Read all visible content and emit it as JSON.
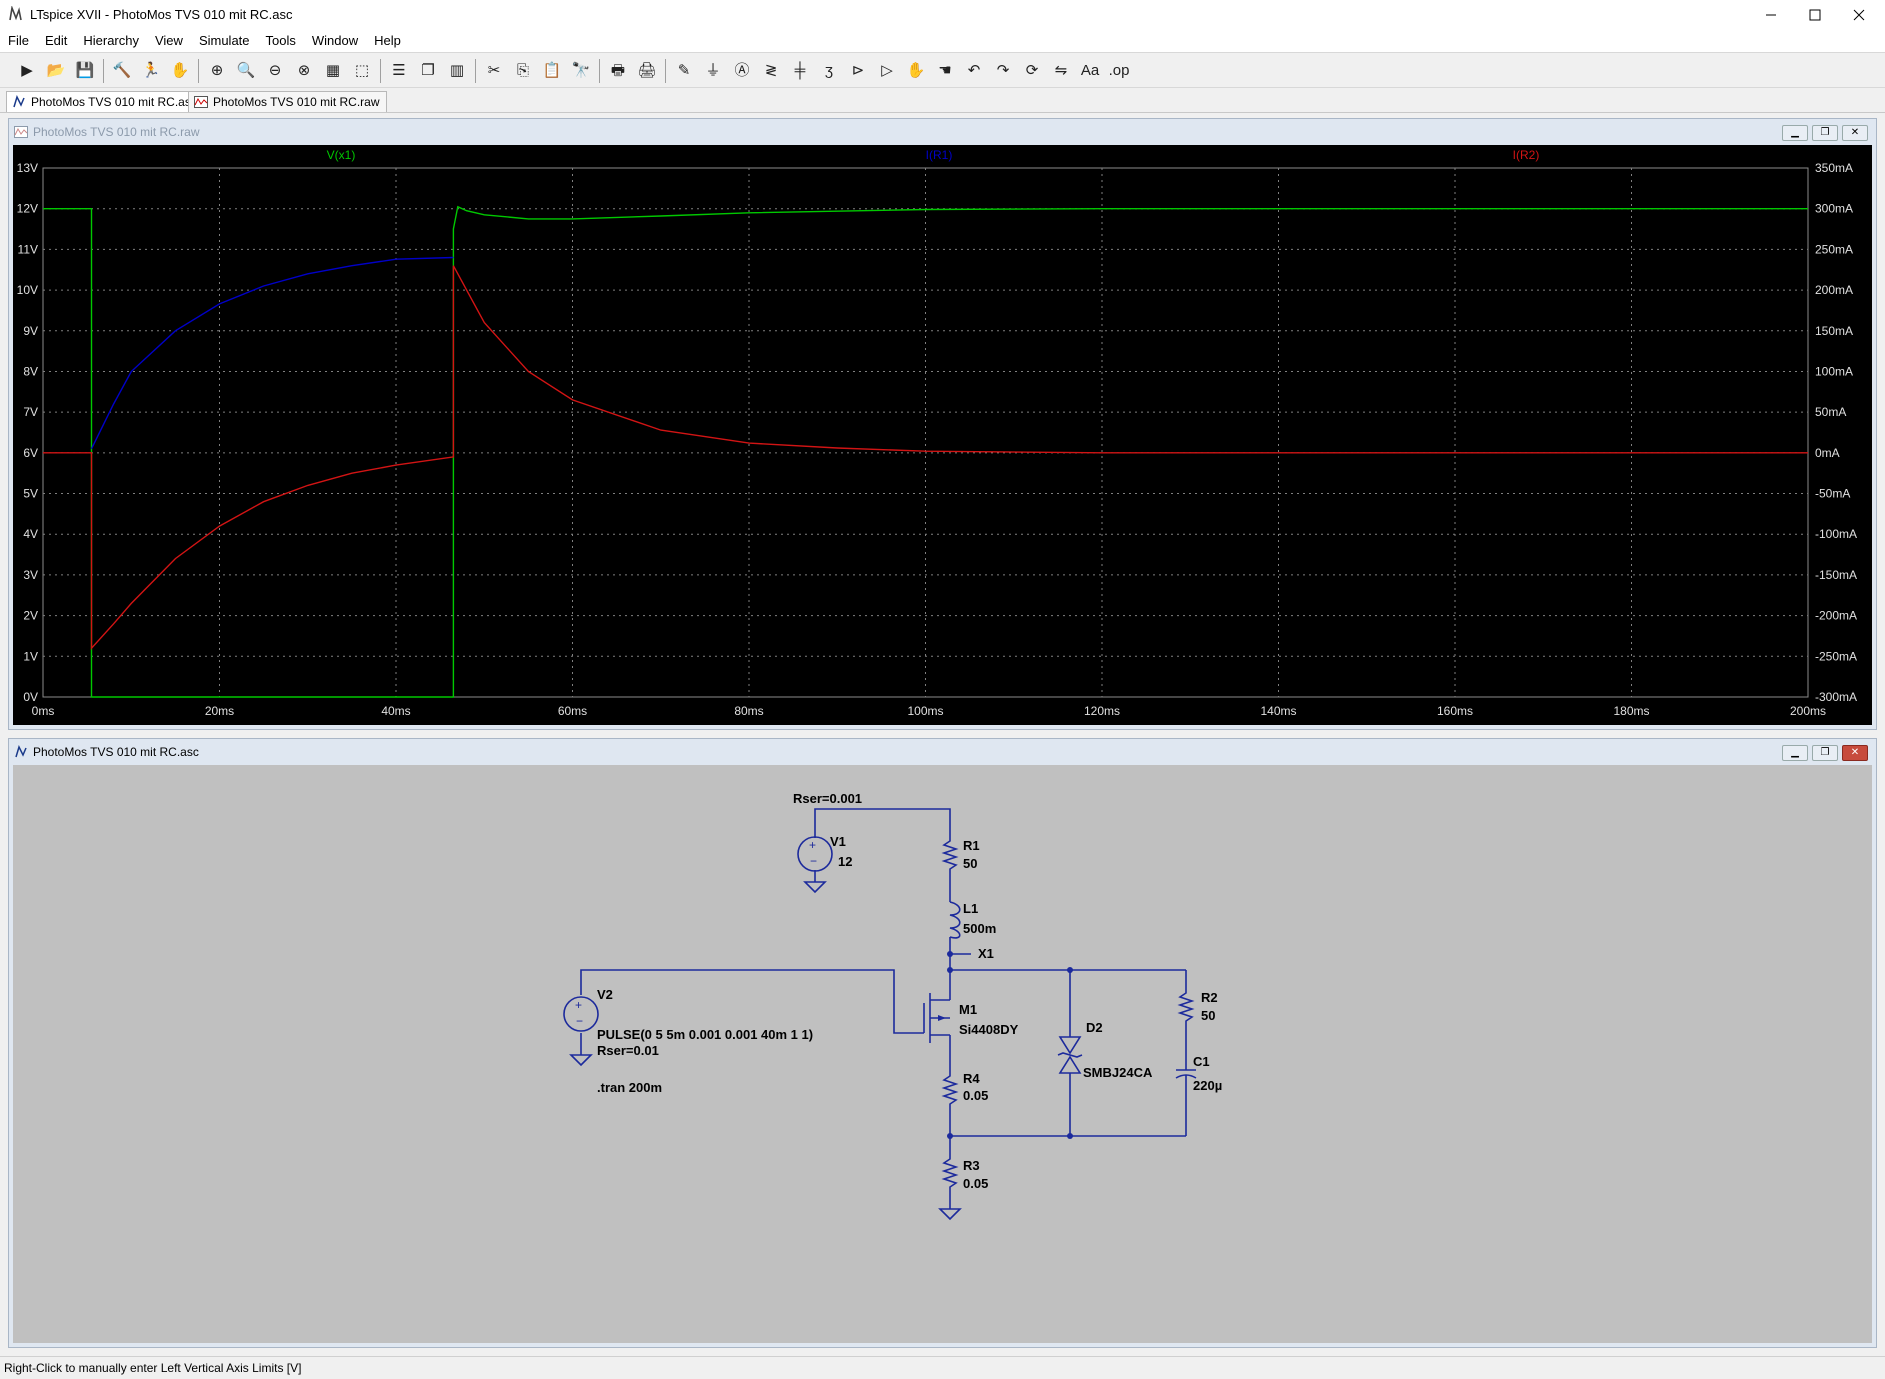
{
  "window": {
    "title": "LTspice XVII - PhotoMos TVS 010 mit RC.asc"
  },
  "menu": [
    "File",
    "Edit",
    "Hierarchy",
    "View",
    "Simulate",
    "Tools",
    "Window",
    "Help"
  ],
  "toolbar_icons": [
    "run-icon",
    "open-icon",
    "save-icon",
    "control-panel-icon",
    "halt-icon",
    "pan-icon",
    "zoom-in-icon",
    "zoom-fit-icon",
    "zoom-out-icon",
    "zoom-cancel-icon",
    "autorange-icon",
    "unzoom-icon",
    "tile-horizontal-icon",
    "cascade-icon",
    "tile-vertical-icon",
    "cut-icon",
    "copy-icon",
    "paste-icon",
    "find-icon",
    "print-icon",
    "print-setup-icon",
    "draw-wire-icon",
    "ground-icon",
    "label-net-icon",
    "resistor-icon",
    "capacitor-icon",
    "inductor-icon",
    "diode-icon",
    "component-icon",
    "move-icon",
    "drag-icon",
    "undo-icon",
    "redo-icon",
    "rotate-icon",
    "mirror-icon",
    "text-icon",
    "spice-directive-icon"
  ],
  "tabs": [
    {
      "label": "PhotoMos TVS 010 mit RC.asc",
      "icon": "schematic-icon"
    },
    {
      "label": "PhotoMos TVS 010 mit RC.raw",
      "icon": "waveform-icon"
    }
  ],
  "waveform_window": {
    "title": "PhotoMos TVS 010 mit RC.raw"
  },
  "schematic_window": {
    "title": "PhotoMos TVS 010 mit RC.asc"
  },
  "status": "Right-Click to manually enter Left Vertical Axis Limits [V]",
  "chart_data": {
    "type": "line",
    "grid": true,
    "xlim": [
      0,
      200
    ],
    "ylim_left": [
      0,
      13
    ],
    "ylim_right": [
      -300,
      350
    ],
    "x_ticks": [
      "0ms",
      "20ms",
      "40ms",
      "60ms",
      "80ms",
      "100ms",
      "120ms",
      "140ms",
      "160ms",
      "180ms",
      "200ms"
    ],
    "y_left_ticks": [
      "0V",
      "1V",
      "2V",
      "3V",
      "4V",
      "5V",
      "6V",
      "7V",
      "8V",
      "9V",
      "10V",
      "11V",
      "12V",
      "13V"
    ],
    "y_right_ticks": [
      "-300mA",
      "-250mA",
      "-200mA",
      "-150mA",
      "-100mA",
      "-50mA",
      "0mA",
      "50mA",
      "100mA",
      "150mA",
      "200mA",
      "250mA",
      "300mA",
      "350mA"
    ],
    "series": [
      {
        "name": "V(x1)",
        "color": "#00c800",
        "axis": "left",
        "x": [
          0,
          5.5,
          5.5,
          46.5,
          46.5,
          47,
          48,
          50,
          55,
          60,
          70,
          80,
          100,
          120,
          200
        ],
        "y": [
          12,
          12,
          0,
          0,
          11.5,
          12.05,
          11.95,
          11.85,
          11.75,
          11.75,
          11.82,
          11.9,
          11.98,
          12,
          12
        ]
      },
      {
        "name": "I(R1)",
        "color": "#0000c8",
        "axis": "right",
        "x": [
          5.5,
          8,
          10,
          15,
          20,
          25,
          30,
          35,
          40,
          46.5
        ],
        "y": [
          5,
          60,
          100,
          150,
          183,
          205,
          220,
          230,
          238,
          240
        ]
      },
      {
        "name": "I(R2)",
        "color": "#d21414",
        "axis": "right",
        "x": [
          0,
          5.5,
          5.5,
          8,
          10,
          15,
          20,
          25,
          30,
          35,
          40,
          46.5,
          46.5,
          50,
          55,
          60,
          70,
          80,
          90,
          100,
          120,
          200
        ],
        "y": [
          0,
          0,
          -240,
          -210,
          -185,
          -130,
          -90,
          -60,
          -40,
          -25,
          -15,
          -5,
          230,
          160,
          100,
          65,
          28,
          12,
          6,
          2,
          0,
          0
        ]
      }
    ]
  },
  "schematic": {
    "V1": {
      "name": "V1",
      "value": "12",
      "rser": "Rser=0.001"
    },
    "R1": {
      "name": "R1",
      "value": "50"
    },
    "L1": {
      "name": "L1",
      "value": "500m"
    },
    "X1": {
      "name": "X1"
    },
    "V2": {
      "name": "V2",
      "value": "PULSE(0 5 5m 0.001 0.001 40m 1 1)",
      "rser": "Rser=0.01"
    },
    "M1": {
      "name": "M1",
      "value": "Si4408DY"
    },
    "D2": {
      "name": "D2",
      "value": "SMBJ24CA"
    },
    "R2": {
      "name": "R2",
      "value": "50"
    },
    "C1": {
      "name": "C1",
      "value": "220µ"
    },
    "R4": {
      "name": "R4",
      "value": "0.05"
    },
    "R3": {
      "name": "R3",
      "value": "0.05"
    },
    "directive": ".tran 200m"
  }
}
